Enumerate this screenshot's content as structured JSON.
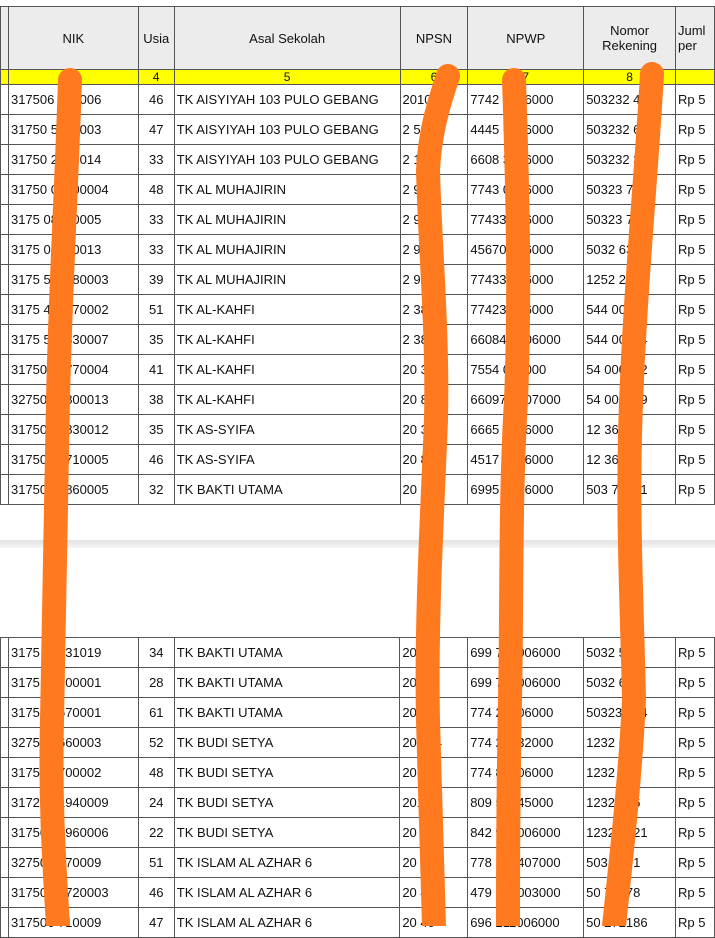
{
  "headers": {
    "col0": "",
    "nik": "NIK",
    "usia": "Usia",
    "asal_sekolah": "Asal Sekolah",
    "npsn": "NPSN",
    "npwp": "NPWP",
    "nomor_rekening": "Nomor Rekening",
    "jumlah": "Juml per"
  },
  "column_numbers": [
    "",
    "",
    "4",
    "5",
    "6",
    "7",
    "8",
    ""
  ],
  "rows_top": [
    {
      "nik": "317506 710006",
      "usia": "46",
      "sekolah": "TK AISYIYAH 103 PULO GEBANG",
      "npsn": "2010 1",
      "npwp": "7742 2006000",
      "rek": "503232 47",
      "jumlah": "Rp 5"
    },
    {
      "nik": "31750 5700003",
      "usia": "47",
      "sekolah": "TK AISYIYAH 103 PULO GEBANG",
      "npsn": "2 51",
      "npwp": "4445 6006000",
      "rek": "503232 63",
      "jumlah": "Rp 5"
    },
    {
      "nik": "31750 2850014",
      "usia": "33",
      "sekolah": "TK AISYIYAH 103 PULO GEBANG",
      "npsn": "2 1",
      "npwp": "6608 3006000",
      "rek": "503232 35",
      "jumlah": "Rp 5"
    },
    {
      "nik": "31750 01700004",
      "usia": "48",
      "sekolah": "TK AL MUHAJIRIN",
      "npsn": "2 97",
      "npwp": "7743 0006000",
      "rek": "50323 79",
      "jumlah": "Rp 5"
    },
    {
      "nik": "3175 08840005",
      "usia": "33",
      "sekolah": "TK AL MUHAJIRIN",
      "npsn": "2 97",
      "npwp": "77433 006000",
      "rek": "50323 787",
      "jumlah": "Rp 5"
    },
    {
      "nik": "3175 08840013",
      "usia": "33",
      "sekolah": "TK AL MUHAJIRIN",
      "npsn": "2 97",
      "npwp": "45670 006000",
      "rek": "5032 639",
      "jumlah": "Rp 5"
    },
    {
      "nik": "3175 505780003",
      "usia": "39",
      "sekolah": "TK AL MUHAJIRIN",
      "npsn": "2 97",
      "npwp": "77433 006000",
      "rek": "1252 2272",
      "jumlah": "Rp 5"
    },
    {
      "nik": "3175 405670002",
      "usia": "51",
      "sekolah": "TK AL-KAHFI",
      "npsn": "2 38",
      "npwp": "77423 006000",
      "rek": "544 00906",
      "jumlah": "Rp 5"
    },
    {
      "nik": "3175 504830007",
      "usia": "35",
      "sekolah": "TK AL-KAHFI",
      "npsn": "2 38",
      "npwp": "66084 9006000",
      "rek": "544 00914",
      "jumlah": "Rp 5"
    },
    {
      "nik": "31750 01770004",
      "usia": "41",
      "sekolah": "TK AL-KAHFI",
      "npsn": "20 38",
      "npwp": "7554 004000",
      "rek": "54 000892",
      "jumlah": "Rp 5"
    },
    {
      "nik": "32750 05800013",
      "usia": "38",
      "sekolah": "TK AL-KAHFI",
      "npsn": "20 8",
      "npwp": "66097 2407000",
      "rek": "54 000949",
      "jumlah": "Rp 5"
    },
    {
      "nik": "31750 08830012",
      "usia": "35",
      "sekolah": "TK AS-SYIFA",
      "npsn": "20 3",
      "npwp": "6665 0006000",
      "rek": "12 36672",
      "jumlah": "Rp 5"
    },
    {
      "nik": "31750 03710005",
      "usia": "46",
      "sekolah": "TK AS-SYIFA",
      "npsn": "20 843",
      "npwp": "4517 0006000",
      "rek": "12 36265",
      "jumlah": "Rp 5"
    },
    {
      "nik": "31750 04860005",
      "usia": "32",
      "sekolah": "TK BAKTI UTAMA",
      "npsn": "20 327",
      "npwp": "6995 2006000",
      "rek": "503 72721",
      "jumlah": "Rp 5"
    }
  ],
  "rows_bottom": [
    {
      "nik": "3175 05131019",
      "usia": "34",
      "sekolah": "TK BAKTI UTAMA",
      "npsn": "20 27",
      "npwp": "699 754006000",
      "rek": "5032 526",
      "jumlah": "Rp 5"
    },
    {
      "nik": "3175 10900001",
      "usia": "28",
      "sekolah": "TK BAKTI UTAMA",
      "npsn": "20 27",
      "npwp": "699 747006000",
      "rek": "5032 666",
      "jumlah": "Rp 5"
    },
    {
      "nik": "3175 08570001",
      "usia": "61",
      "sekolah": "TK BAKTI UTAMA",
      "npsn": "20 27",
      "npwp": "774 27006000",
      "rek": "50323 674",
      "jumlah": "Rp 5"
    },
    {
      "nik": "3275 09660003",
      "usia": "52",
      "sekolah": "TK BUDI SETYA",
      "npsn": "201 24",
      "npwp": "774 24432000",
      "rek": "1232 639",
      "jumlah": "Rp 5"
    },
    {
      "nik": "3175 10700002",
      "usia": "48",
      "sekolah": "TK BUDI SETYA",
      "npsn": "201 4",
      "npwp": "774 85006000",
      "rek": "1232 931",
      "jumlah": "Rp 5"
    },
    {
      "nik": "31720 01940009",
      "usia": "24",
      "sekolah": "TK BUDI SETYA",
      "npsn": "201 24",
      "npwp": "809 56045000",
      "rek": "1232 966",
      "jumlah": "Rp 5"
    },
    {
      "nik": "31750 03960006",
      "usia": "22",
      "sekolah": "TK BUDI SETYA",
      "npsn": "20 24",
      "npwp": "842 985006000",
      "rek": "1232 2121",
      "jumlah": "Rp 5"
    },
    {
      "nik": "32750 5670009",
      "usia": "51",
      "sekolah": "TK ISLAM AL AZHAR 6",
      "npsn": "20 40",
      "npwp": "778 132407000",
      "rek": "503 2151",
      "jumlah": "Rp 5"
    },
    {
      "nik": "317502 0720003",
      "usia": "46",
      "sekolah": "TK ISLAM AL AZHAR 6",
      "npsn": "20 40",
      "npwp": "479 153003000",
      "rek": "50 72178",
      "jumlah": "Rp 5"
    },
    {
      "nik": "317506 710009",
      "usia": "47",
      "sekolah": "TK ISLAM AL AZHAR 6",
      "npsn": "20 40",
      "npwp": "696 211006000",
      "rek": "50 272186",
      "jumlah": "Rp 5"
    }
  ],
  "colors": {
    "header_bg": "#ececec",
    "number_row_bg": "#ffff00",
    "redaction_stroke": "#ff7a1f"
  }
}
